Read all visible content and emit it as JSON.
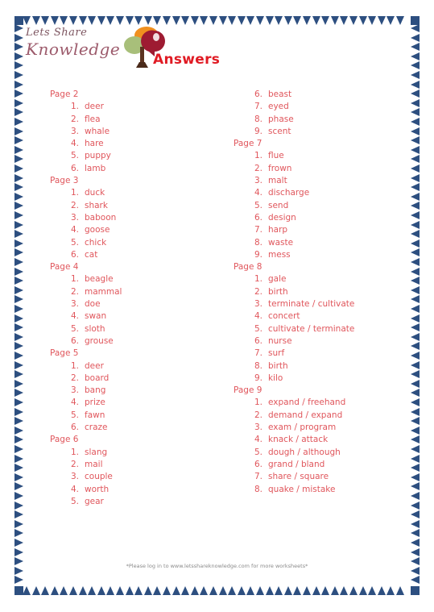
{
  "document": {
    "title": "Answers",
    "title_color": "#e01b24",
    "border_color": "#2d4f80",
    "answer_text_color": "#e0565c"
  },
  "logo": {
    "line1": "Lets Share",
    "line2": "Knowledge",
    "tree_icon": "tree-icon"
  },
  "footer": {
    "note": "*Please log in to www.letsshareknowledge.com for more worksheets*"
  },
  "columns": [
    {
      "name": "left-column",
      "sections": [
        {
          "page_label": "Page 2",
          "answers": [
            {
              "num": "1.",
              "text": "deer"
            },
            {
              "num": "2.",
              "text": "flea"
            },
            {
              "num": "3.",
              "text": "whale"
            },
            {
              "num": "4.",
              "text": "hare"
            },
            {
              "num": "5.",
              "text": "puppy"
            },
            {
              "num": "6.",
              "text": "lamb"
            }
          ]
        },
        {
          "page_label": "Page 3",
          "answers": [
            {
              "num": "1.",
              "text": "duck"
            },
            {
              "num": "2.",
              "text": "shark"
            },
            {
              "num": "3.",
              "text": "baboon"
            },
            {
              "num": "4.",
              "text": "goose"
            },
            {
              "num": "5.",
              "text": "chick"
            },
            {
              "num": "6.",
              "text": "cat"
            }
          ]
        },
        {
          "page_label": "Page 4",
          "answers": [
            {
              "num": "1.",
              "text": "beagle"
            },
            {
              "num": "2.",
              "text": "mammal"
            },
            {
              "num": "3.",
              "text": "doe"
            },
            {
              "num": "4.",
              "text": "swan"
            },
            {
              "num": "5.",
              "text": "sloth"
            },
            {
              "num": "6.",
              "text": "grouse"
            }
          ]
        },
        {
          "page_label": "Page 5",
          "answers": [
            {
              "num": "1.",
              "text": "deer"
            },
            {
              "num": "2.",
              "text": "board"
            },
            {
              "num": "3.",
              "text": "bang"
            },
            {
              "num": "4.",
              "text": "prize"
            },
            {
              "num": "5.",
              "text": "fawn"
            },
            {
              "num": "6.",
              "text": "craze"
            }
          ]
        },
        {
          "page_label": "Page 6",
          "answers": [
            {
              "num": "1.",
              "text": "slang"
            },
            {
              "num": "2.",
              "text": "mail"
            },
            {
              "num": "3.",
              "text": "couple"
            },
            {
              "num": "4.",
              "text": "worth"
            },
            {
              "num": "5.",
              "text": "gear"
            }
          ]
        }
      ]
    },
    {
      "name": "right-column",
      "sections": [
        {
          "page_label": "",
          "answers": [
            {
              "num": "6.",
              "text": "beast"
            },
            {
              "num": "7.",
              "text": "eyed"
            },
            {
              "num": "8.",
              "text": "phase"
            },
            {
              "num": "9.",
              "text": "scent"
            }
          ]
        },
        {
          "page_label": "Page 7",
          "answers": [
            {
              "num": "1.",
              "text": "flue"
            },
            {
              "num": "2.",
              "text": "frown"
            },
            {
              "num": "3.",
              "text": "malt"
            },
            {
              "num": "4.",
              "text": "discharge"
            },
            {
              "num": "5.",
              "text": "send"
            },
            {
              "num": "6.",
              "text": "design"
            },
            {
              "num": "7.",
              "text": "harp"
            },
            {
              "num": "8.",
              "text": "waste"
            },
            {
              "num": "9.",
              "text": "mess"
            }
          ]
        },
        {
          "page_label": "Page 8",
          "answers": [
            {
              "num": "1.",
              "text": "gale"
            },
            {
              "num": "2.",
              "text": "birth"
            },
            {
              "num": "3.",
              "text": "terminate / cultivate"
            },
            {
              "num": "4.",
              "text": "concert"
            },
            {
              "num": "5.",
              "text": "cultivate / terminate"
            },
            {
              "num": "6.",
              "text": "nurse"
            },
            {
              "num": "7.",
              "text": "surf"
            },
            {
              "num": "8.",
              "text": "birth"
            },
            {
              "num": "9.",
              "text": "kilo"
            }
          ]
        },
        {
          "page_label": "Page 9",
          "answers": [
            {
              "num": "1.",
              "text": "expand / freehand"
            },
            {
              "num": "2.",
              "text": "demand / expand"
            },
            {
              "num": "3.",
              "text": "exam / program"
            },
            {
              "num": "4.",
              "text": "knack / attack"
            },
            {
              "num": "5.",
              "text": "dough / although"
            },
            {
              "num": "6.",
              "text": "grand / bland"
            },
            {
              "num": "7.",
              "text": "share / square"
            },
            {
              "num": "8.",
              "text": "quake / mistake"
            }
          ]
        }
      ]
    }
  ]
}
